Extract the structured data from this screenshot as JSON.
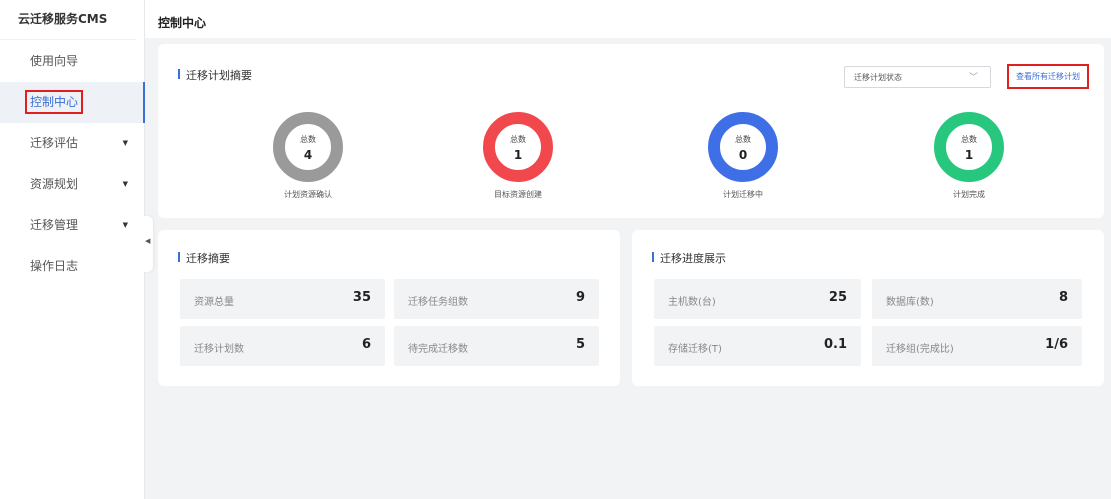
{
  "app": {
    "brand": "云迁移服务CMS"
  },
  "sidebar": {
    "items": [
      {
        "label": "使用向导",
        "has_caret": false
      },
      {
        "label": "控制中心",
        "has_caret": false,
        "active": true
      },
      {
        "label": "迁移评估",
        "has_caret": true
      },
      {
        "label": "资源规划",
        "has_caret": true
      },
      {
        "label": "迁移管理",
        "has_caret": true
      },
      {
        "label": "操作日志",
        "has_caret": false
      }
    ],
    "caret_glyph": "▼",
    "collapse_glyph": "◀"
  },
  "header": {
    "title": "控制中心"
  },
  "plan_summary": {
    "title": "迁移计划摘要",
    "status_select": {
      "value": "迁移计划状态",
      "chevron": "﹀"
    },
    "view_all_label": "查看所有迁移计划",
    "total_label": "总数",
    "stats": [
      {
        "count": "4",
        "caption": "计划资源确认",
        "color": "#9a9a9a"
      },
      {
        "count": "1",
        "caption": "目标资源创建",
        "color": "#f0484d"
      },
      {
        "count": "0",
        "caption": "计划迁移中",
        "color": "#3f6fe6"
      },
      {
        "count": "1",
        "caption": "计划完成",
        "color": "#27c77e"
      }
    ]
  },
  "migration_summary": {
    "title": "迁移摘要",
    "tiles": [
      {
        "label": "资源总量",
        "value": "35"
      },
      {
        "label": "迁移任务组数",
        "value": "9"
      },
      {
        "label": "迁移计划数",
        "value": "6"
      },
      {
        "label": "待完成迁移数",
        "value": "5"
      }
    ]
  },
  "progress": {
    "title": "迁移进度展示",
    "tiles": [
      {
        "label": "主机数(台)",
        "value": "25"
      },
      {
        "label": "数据库(数)",
        "value": "8"
      },
      {
        "label": "存储迁移(T)",
        "value": "0.1"
      },
      {
        "label": "迁移组(完成比)",
        "value": "1/6"
      }
    ]
  }
}
